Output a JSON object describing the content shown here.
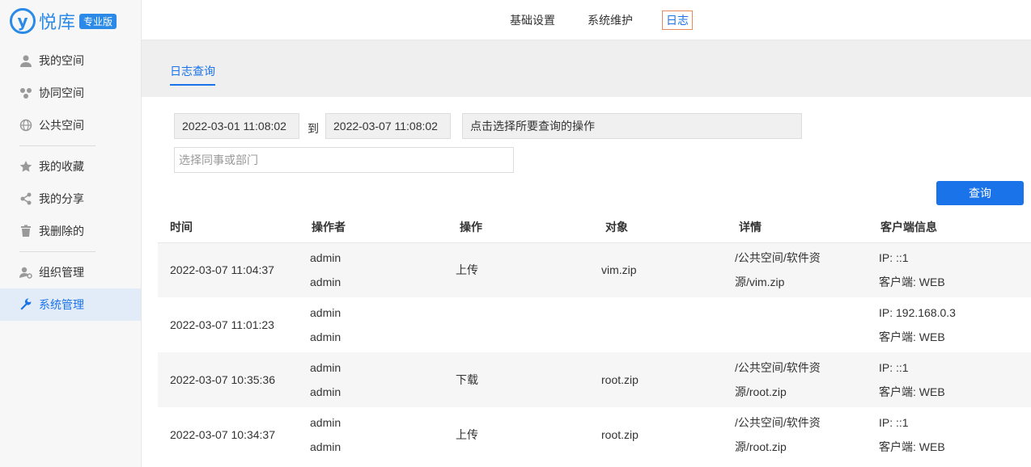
{
  "logo": {
    "mark": "y",
    "name": "悦库",
    "badge": "专业版"
  },
  "sidebar": {
    "items": [
      {
        "label": "我的空间",
        "icon": "user-icon"
      },
      {
        "label": "协同空间",
        "icon": "collaboration-icon"
      },
      {
        "label": "公共空间",
        "icon": "globe-icon"
      },
      {
        "label": "我的收藏",
        "icon": "star-icon"
      },
      {
        "label": "我的分享",
        "icon": "share-icon"
      },
      {
        "label": "我删除的",
        "icon": "trash-icon"
      },
      {
        "label": "组织管理",
        "icon": "org-icon"
      },
      {
        "label": "系统管理",
        "icon": "wrench-icon"
      }
    ]
  },
  "topnav": {
    "basic": "基础设置",
    "maintain": "系统维护",
    "log": "日志"
  },
  "tabs": {
    "log_query": "日志查询"
  },
  "filters": {
    "start": "2022-03-01 11:08:02",
    "to": "到",
    "end": "2022-03-07 11:08:02",
    "operation_placeholder": "点击选择所要查询的操作",
    "user_placeholder": "选择同事或部门",
    "query": "查询"
  },
  "table": {
    "headers": {
      "time": "时间",
      "operator": "操作者",
      "action": "操作",
      "object": "对象",
      "detail": "详情",
      "client": "客户端信息"
    },
    "rows": [
      {
        "time": "2022-03-07 11:04:37",
        "op1": "admin",
        "op2": "admin",
        "action": "上传",
        "object": "vim.zip",
        "detail1": "/公共空间/软件资",
        "detail2": "源/vim.zip",
        "ip": "IP: ::1",
        "client": "客户端: WEB"
      },
      {
        "time": "2022-03-07 11:01:23",
        "op1": "admin",
        "op2": "admin",
        "action": "",
        "object": "",
        "detail1": "",
        "detail2": "",
        "ip": "IP: 192.168.0.3",
        "client": "客户端: WEB"
      },
      {
        "time": "2022-03-07 10:35:36",
        "op1": "admin",
        "op2": "admin",
        "action": "下载",
        "object": "root.zip",
        "detail1": "/公共空间/软件资",
        "detail2": "源/root.zip",
        "ip": "IP: ::1",
        "client": "客户端: WEB"
      },
      {
        "time": "2022-03-07 10:34:37",
        "op1": "admin",
        "op2": "admin",
        "action": "上传",
        "object": "root.zip",
        "detail1": "/公共空间/软件资",
        "detail2": "源/root.zip",
        "ip": "IP: ::1",
        "client": "客户端: WEB"
      }
    ]
  },
  "colors": {
    "accent": "#1a73e8",
    "brand": "#2b8ae8",
    "active_bg": "#e2ecf8"
  }
}
